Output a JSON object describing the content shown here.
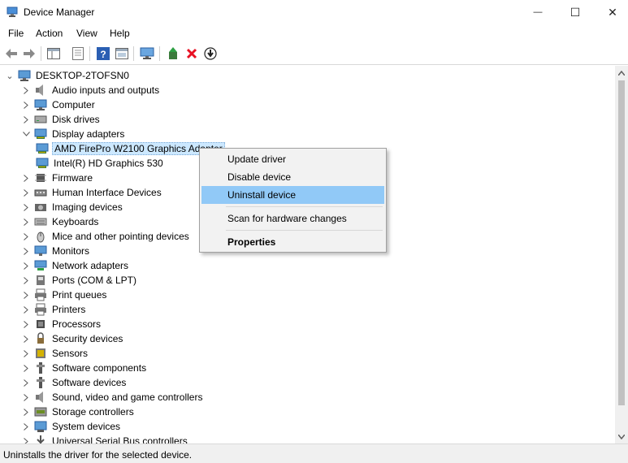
{
  "window": {
    "title": "Device Manager",
    "minimize_glyph": "—",
    "maximize_glyph": "☐",
    "close_glyph": "✕"
  },
  "menubar": {
    "items": [
      "File",
      "Action",
      "View",
      "Help"
    ]
  },
  "toolbar": {
    "icons": [
      "back-icon",
      "forward-icon",
      "show-hide-icon",
      "properties-icon",
      "help-icon",
      "view-icon",
      "scan-changes-icon",
      "update-driver-icon",
      "uninstall-icon",
      "download-icon"
    ]
  },
  "tree": {
    "root": "DESKTOP-2TOFSN0",
    "nodes": [
      {
        "label": "Audio inputs and outputs",
        "icon": "speaker-icon"
      },
      {
        "label": "Computer",
        "icon": "computer-icon"
      },
      {
        "label": "Disk drives",
        "icon": "disk-icon"
      },
      {
        "label": "Display adapters",
        "icon": "display-adapter-icon",
        "expanded": true
      },
      {
        "label": "AMD FirePro W2100 Graphics Adapter",
        "icon": "display-adapter-icon",
        "child": true,
        "selected": true
      },
      {
        "label": "Intel(R) HD Graphics 530",
        "icon": "display-adapter-icon",
        "child": true
      },
      {
        "label": "Firmware",
        "icon": "chip-icon"
      },
      {
        "label": "Human Interface Devices",
        "icon": "hid-icon"
      },
      {
        "label": "Imaging devices",
        "icon": "camera-icon"
      },
      {
        "label": "Keyboards",
        "icon": "keyboard-icon"
      },
      {
        "label": "Mice and other pointing devices",
        "icon": "mouse-icon"
      },
      {
        "label": "Monitors",
        "icon": "monitor-icon"
      },
      {
        "label": "Network adapters",
        "icon": "network-icon"
      },
      {
        "label": "Ports (COM & LPT)",
        "icon": "port-icon"
      },
      {
        "label": "Print queues",
        "icon": "printer-icon"
      },
      {
        "label": "Printers",
        "icon": "printer-icon"
      },
      {
        "label": "Processors",
        "icon": "processor-icon"
      },
      {
        "label": "Security devices",
        "icon": "security-icon"
      },
      {
        "label": "Sensors",
        "icon": "sensor-icon"
      },
      {
        "label": "Software components",
        "icon": "software-icon"
      },
      {
        "label": "Software devices",
        "icon": "software-icon"
      },
      {
        "label": "Sound, video and game controllers",
        "icon": "speaker-icon"
      },
      {
        "label": "Storage controllers",
        "icon": "storage-icon"
      },
      {
        "label": "System devices",
        "icon": "system-icon"
      },
      {
        "label": "Universal Serial Bus controllers",
        "icon": "usb-icon"
      }
    ]
  },
  "context_menu": {
    "items": [
      {
        "label": "Update driver"
      },
      {
        "label": "Disable device"
      },
      {
        "label": "Uninstall device",
        "highlighted": true
      },
      {
        "label": "Scan for hardware changes"
      },
      {
        "label": "Properties",
        "bold": true
      }
    ]
  },
  "status": {
    "text": "Uninstalls the driver for the selected device."
  },
  "colors": {
    "selection": "#cce8ff",
    "menu_highlight": "#91c9f7",
    "uninstall_red": "#e81123"
  }
}
